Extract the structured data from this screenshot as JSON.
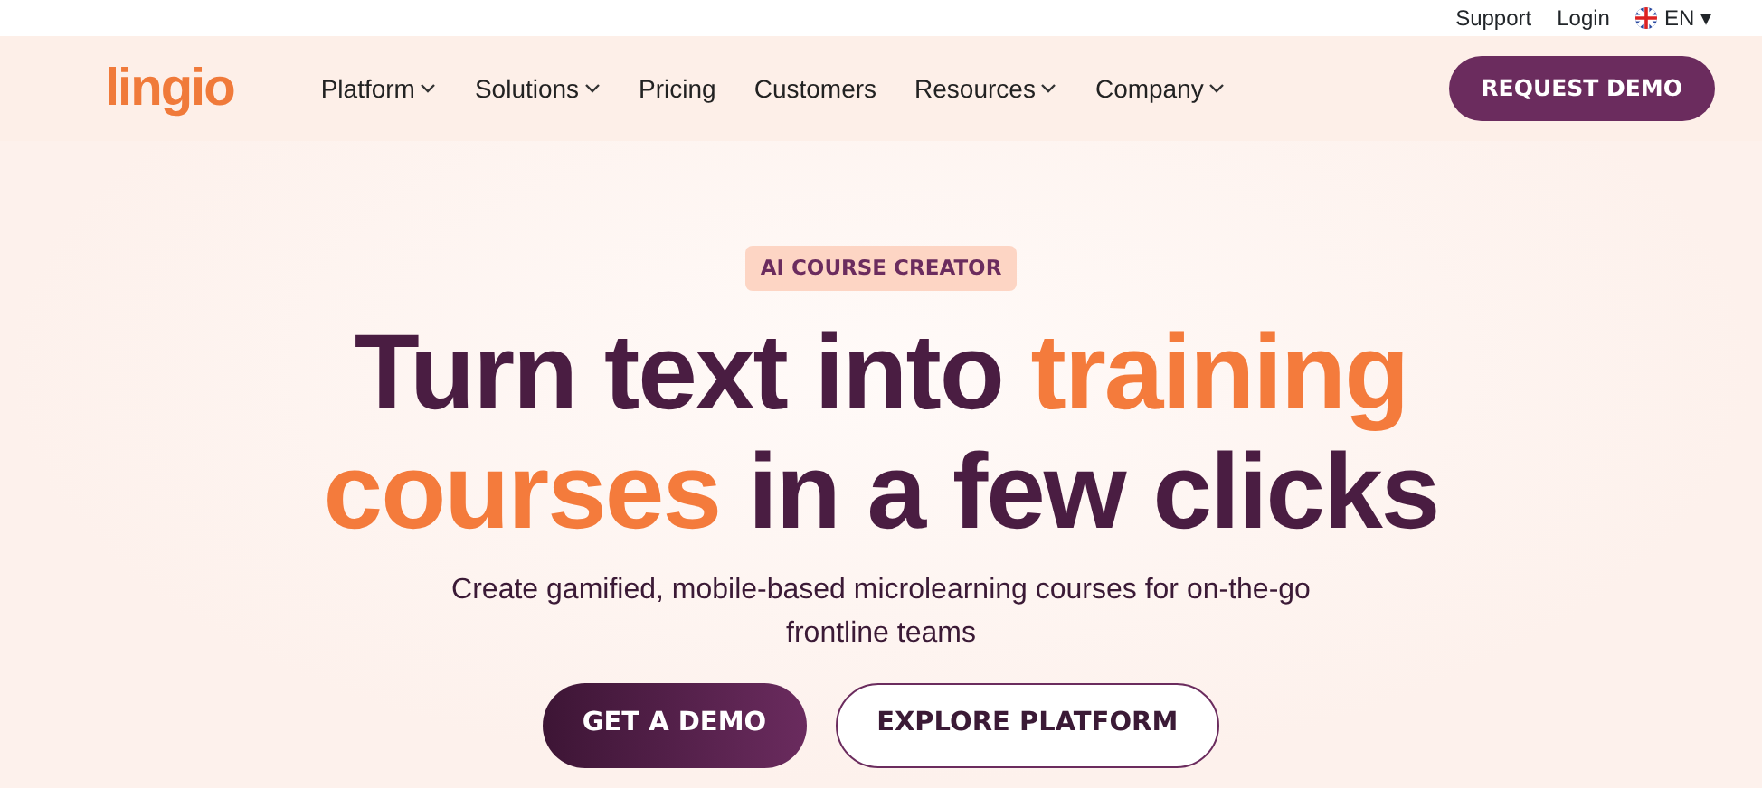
{
  "top_bar": {
    "links": [
      "Support",
      "Login"
    ],
    "language": {
      "label": "EN",
      "caret": "▾"
    }
  },
  "header": {
    "logo": "lingio",
    "nav": [
      {
        "label": "Platform",
        "dropdown": true
      },
      {
        "label": "Solutions",
        "dropdown": true
      },
      {
        "label": "Pricing",
        "dropdown": false
      },
      {
        "label": "Customers",
        "dropdown": false
      },
      {
        "label": "Resources",
        "dropdown": true
      },
      {
        "label": "Company",
        "dropdown": true
      }
    ],
    "cta": "REQUEST DEMO"
  },
  "hero": {
    "badge": "AI COURSE CREATOR",
    "headline": [
      {
        "text": "Turn text into ",
        "accent": false
      },
      {
        "text": "training courses",
        "accent": true
      },
      {
        "text": " in a few clicks",
        "accent": false
      }
    ],
    "subtitle": "Create gamified, mobile-based microlearning courses for on-the-go frontline teams",
    "buttons": [
      {
        "label": "GET A DEMO",
        "kind": "primary"
      },
      {
        "label": "EXPLORE PLATFORM",
        "kind": "outline"
      }
    ]
  }
}
